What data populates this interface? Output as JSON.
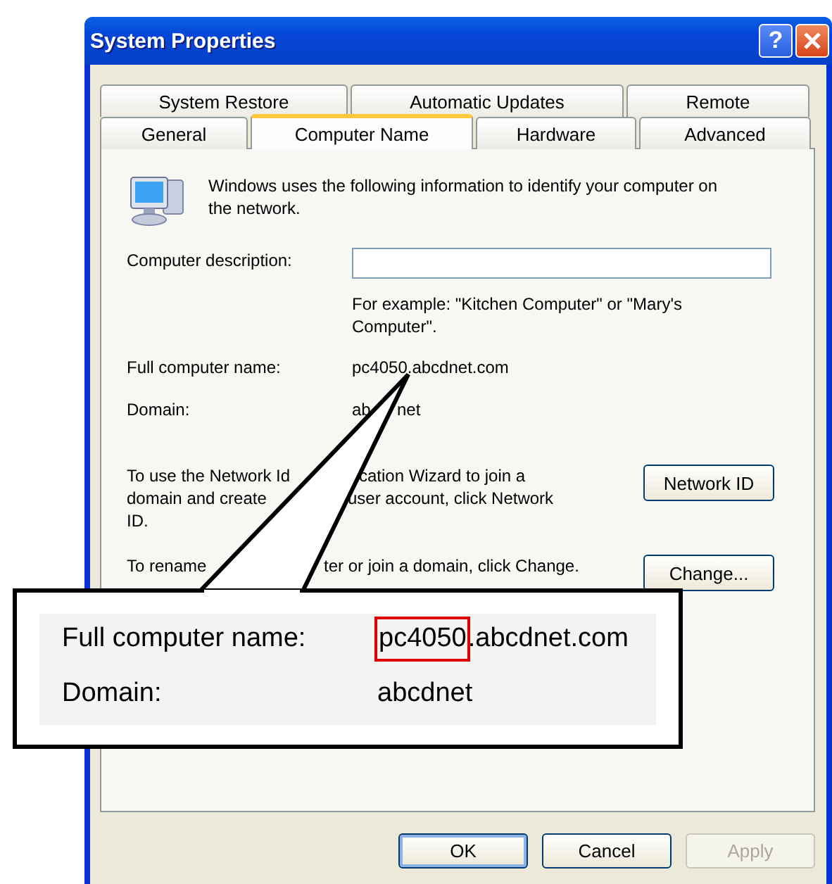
{
  "window": {
    "title": "System Properties",
    "help_glyph": "?"
  },
  "tabs": [
    [
      {
        "label": "System Restore",
        "selected": false
      },
      {
        "label": "Automatic Updates",
        "selected": false
      },
      {
        "label": "Remote",
        "selected": false
      }
    ],
    [
      {
        "label": "General",
        "selected": false
      },
      {
        "label": "Computer Name",
        "selected": true
      },
      {
        "label": "Hardware",
        "selected": false
      },
      {
        "label": "Advanced",
        "selected": false
      }
    ]
  ],
  "intro": "Windows uses the following information to identify your computer on the network.",
  "description": {
    "label": "Computer description:",
    "example": "For example: \"Kitchen Computer\" or \"Mary's Computer\"."
  },
  "fields": [
    {
      "label": "Full computer name:",
      "parts": [
        "pc4050.abcdnet.com"
      ]
    },
    {
      "label": "Domain:",
      "parts": [
        "ab",
        "net"
      ]
    }
  ],
  "actions": [
    {
      "lines": [
        [
          "To use the Network Id",
          "cation Wizard to join a"
        ],
        [
          "domain and create",
          "user account, click Network"
        ],
        [
          "ID."
        ]
      ],
      "button": "Network ID"
    },
    {
      "lines": [
        [
          "To rename",
          "ter or join a domain, click Change."
        ]
      ],
      "button": "Change..."
    }
  ],
  "dialog_buttons": [
    {
      "label": "OK",
      "disabled": false
    },
    {
      "label": "Cancel",
      "disabled": false
    },
    {
      "label": "Apply",
      "disabled": true
    }
  ],
  "callout": {
    "rows": [
      {
        "label": "Full computer name:",
        "highlight": "pc4050",
        "value": ".abcdnet.com"
      },
      {
        "label": "Domain:",
        "value": "abcdnet"
      }
    ]
  }
}
